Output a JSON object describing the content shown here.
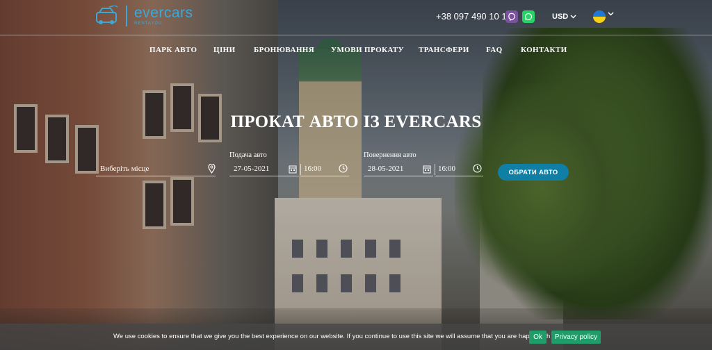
{
  "brand": {
    "name": "evercars",
    "tagline": "RENTAYOU"
  },
  "header": {
    "phone": "+38 097 490 10 10",
    "currency": "USD",
    "accent_color": "#3fa7d6"
  },
  "nav": {
    "items": [
      {
        "label": "ПАРК АВТО"
      },
      {
        "label": "ЦІНИ"
      },
      {
        "label": "БРОНЮВАННЯ"
      },
      {
        "label": "УМОВИ ПРОКАТУ"
      },
      {
        "label": "ТРАНСФЕРИ"
      },
      {
        "label": "FAQ"
      },
      {
        "label": "КОНТАКТИ"
      }
    ]
  },
  "hero": {
    "title": "ПРОКАТ АВТО ІЗ EVERCARS",
    "location_placeholder": "Виберіть місце",
    "pickup": {
      "label": "Подача авто",
      "date": "27-05-2021",
      "time": "16:00"
    },
    "return": {
      "label": "Повернення авто",
      "date": "28-05-2021",
      "time": "16:00"
    },
    "cta_label": "ОБРАТИ АВТО"
  },
  "cookie": {
    "text": "We use cookies to ensure that we give you the best experience on our website. If you continue to use this site we will assume that you are happy with it.",
    "ok_label": "Ok",
    "privacy_label": "Privacy policy"
  }
}
